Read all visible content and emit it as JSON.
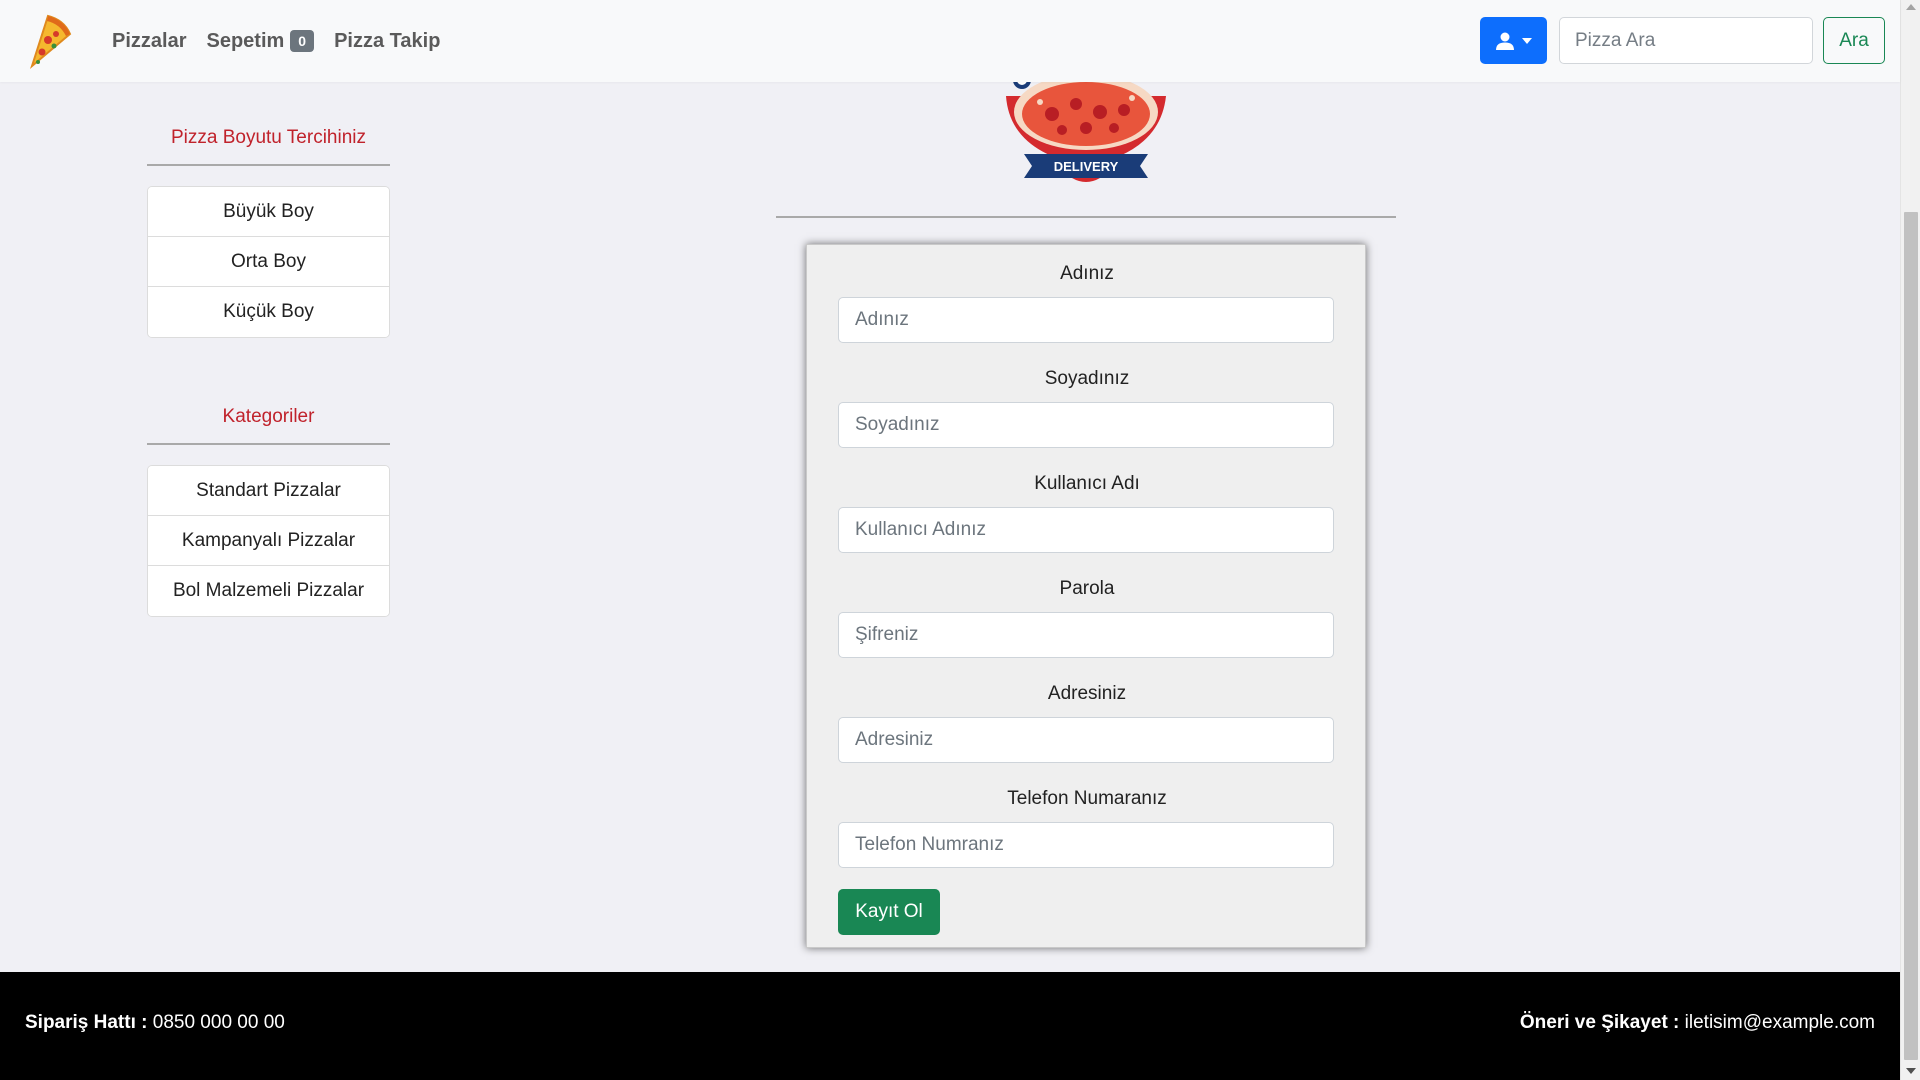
{
  "nav": {
    "links": [
      "Pizzalar",
      "Sepetim",
      "Pizza Takip"
    ],
    "cart_count": "0",
    "search_placeholder": "Pizza Ara",
    "search_button": "Ara",
    "user_icon": "user-icon",
    "caret_icon": "caret-down-icon"
  },
  "sidebar": {
    "size_title": "Pizza Boyutu Tercihiniz",
    "sizes": [
      "Büyük Boy",
      "Orta Boy",
      "Küçük Boy"
    ],
    "category_title": "Kategoriler",
    "categories": [
      "Standart Pizzalar",
      "Kampanyalı Pizzalar",
      "Bol Malzemeli Pizzalar"
    ]
  },
  "logo": {
    "text": "DELIVERY"
  },
  "form": {
    "fields": [
      {
        "label": "Adınız",
        "placeholder": "Adınız"
      },
      {
        "label": "Soyadınız",
        "placeholder": "Soyadınız"
      },
      {
        "label": "Kullanıcı Adı",
        "placeholder": "Kullanıcı Adınız"
      },
      {
        "label": "Parola",
        "placeholder": "Şifreniz"
      },
      {
        "label": "Adresiniz",
        "placeholder": "Adresiniz"
      },
      {
        "label": "Telefon Numaranız",
        "placeholder": "Telefon Numranız"
      }
    ],
    "submit": "Kayıt Ol"
  },
  "footer": {
    "order_label": "Sipariş Hattı :",
    "order_phone": "0850 000 00 00",
    "contact_label": "Öneri ve Şikayet :",
    "contact_email": "iletisim@example.com"
  },
  "colors": {
    "accent_red": "#c0222b",
    "primary_blue": "#0d6efd",
    "success_green": "#198754",
    "footer_bg": "#000000"
  }
}
